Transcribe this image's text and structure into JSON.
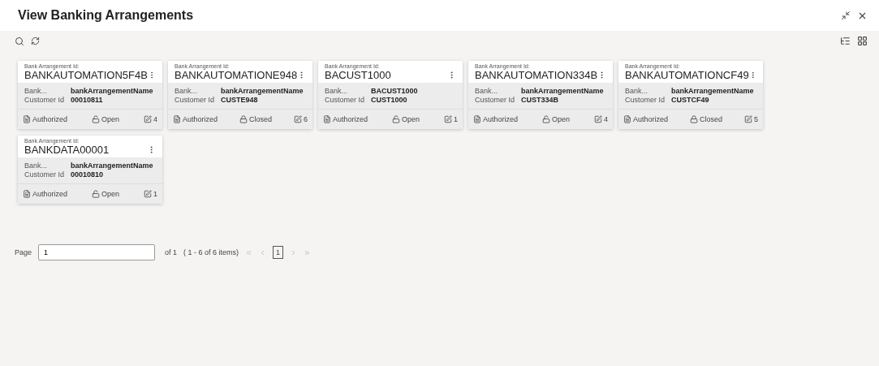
{
  "window": {
    "title": "View Banking Arrangements"
  },
  "cards": [
    {
      "id_label": "Bank Arrangement Id:",
      "id": "BANKAUTOMATION5F4B",
      "fields": [
        {
          "label": "Bank...",
          "value": "bankArrangementName"
        },
        {
          "label": "Customer Id",
          "value": "00010811"
        }
      ],
      "status": "Authorized",
      "locked": false,
      "lock_label": "Open",
      "edits": "4"
    },
    {
      "id_label": "Bank Arrangement Id:",
      "id": "BANKAUTOMATIONE948",
      "fields": [
        {
          "label": "Bank...",
          "value": "bankArrangementName"
        },
        {
          "label": "Customer Id",
          "value": "CUSTE948"
        }
      ],
      "status": "Authorized",
      "locked": true,
      "lock_label": "Closed",
      "edits": "6"
    },
    {
      "id_label": "Bank Arrangement Id:",
      "id": "BACUST1000",
      "fields": [
        {
          "label": "Bank...",
          "value": "BACUST1000"
        },
        {
          "label": "Customer Id",
          "value": "CUST1000"
        }
      ],
      "status": "Authorized",
      "locked": false,
      "lock_label": "Open",
      "edits": "1"
    },
    {
      "id_label": "Bank Arrangement Id:",
      "id": "BANKAUTOMATION334B",
      "fields": [
        {
          "label": "Bank...",
          "value": "bankArrangementName"
        },
        {
          "label": "Customer Id",
          "value": "CUST334B"
        }
      ],
      "status": "Authorized",
      "locked": false,
      "lock_label": "Open",
      "edits": "4"
    },
    {
      "id_label": "Bank Arrangement Id:",
      "id": "BANKAUTOMATIONCF49",
      "fields": [
        {
          "label": "Bank...",
          "value": "bankArrangementName"
        },
        {
          "label": "Customer Id",
          "value": "CUSTCF49"
        }
      ],
      "status": "Authorized",
      "locked": true,
      "lock_label": "Closed",
      "edits": "5"
    },
    {
      "id_label": "Bank Arrangement Id:",
      "id": "BANKDATA00001",
      "fields": [
        {
          "label": "Bank...",
          "value": "bankArrangementName"
        },
        {
          "label": "Customer Id",
          "value": "00010810"
        }
      ],
      "status": "Authorized",
      "locked": false,
      "lock_label": "Open",
      "edits": "1"
    }
  ],
  "pagination": {
    "label": "Page",
    "value": "1",
    "of": "of 1",
    "range": "( 1 - 6 of 6 items)",
    "current": "1"
  }
}
